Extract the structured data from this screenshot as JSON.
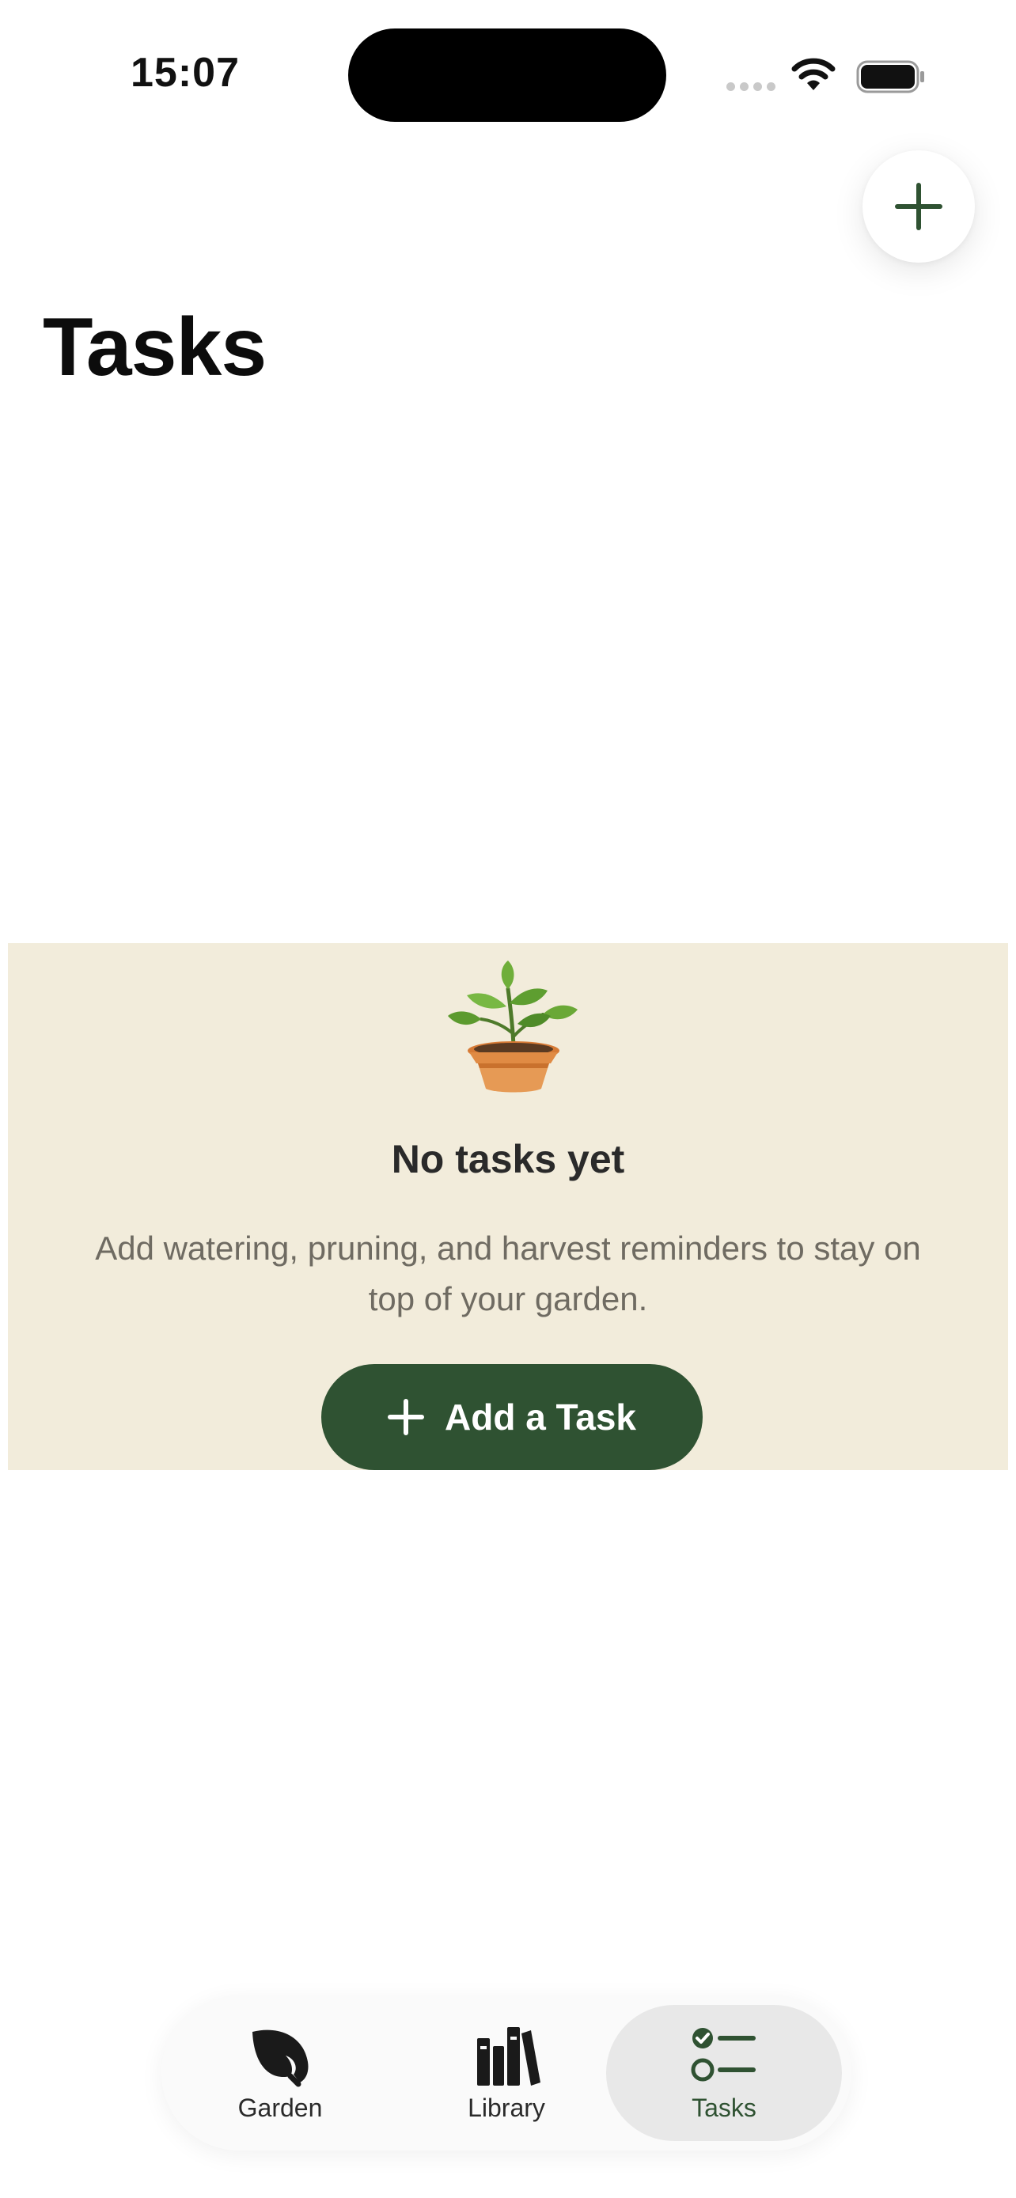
{
  "status_bar": {
    "time": "15:07"
  },
  "header": {
    "title": "Tasks"
  },
  "empty_state": {
    "title": "No tasks yet",
    "description": "Add watering, pruning, and harvest reminders to stay on top of your garden.",
    "button_label": "Add a Task"
  },
  "tab_bar": {
    "items": [
      {
        "label": "Garden",
        "icon": "leaf-icon"
      },
      {
        "label": "Library",
        "icon": "books-icon"
      },
      {
        "label": "Tasks",
        "icon": "checklist-icon",
        "selected": true
      }
    ]
  },
  "colors": {
    "accent": "#2f5232",
    "empty_state_background": "#f2ecdb"
  }
}
